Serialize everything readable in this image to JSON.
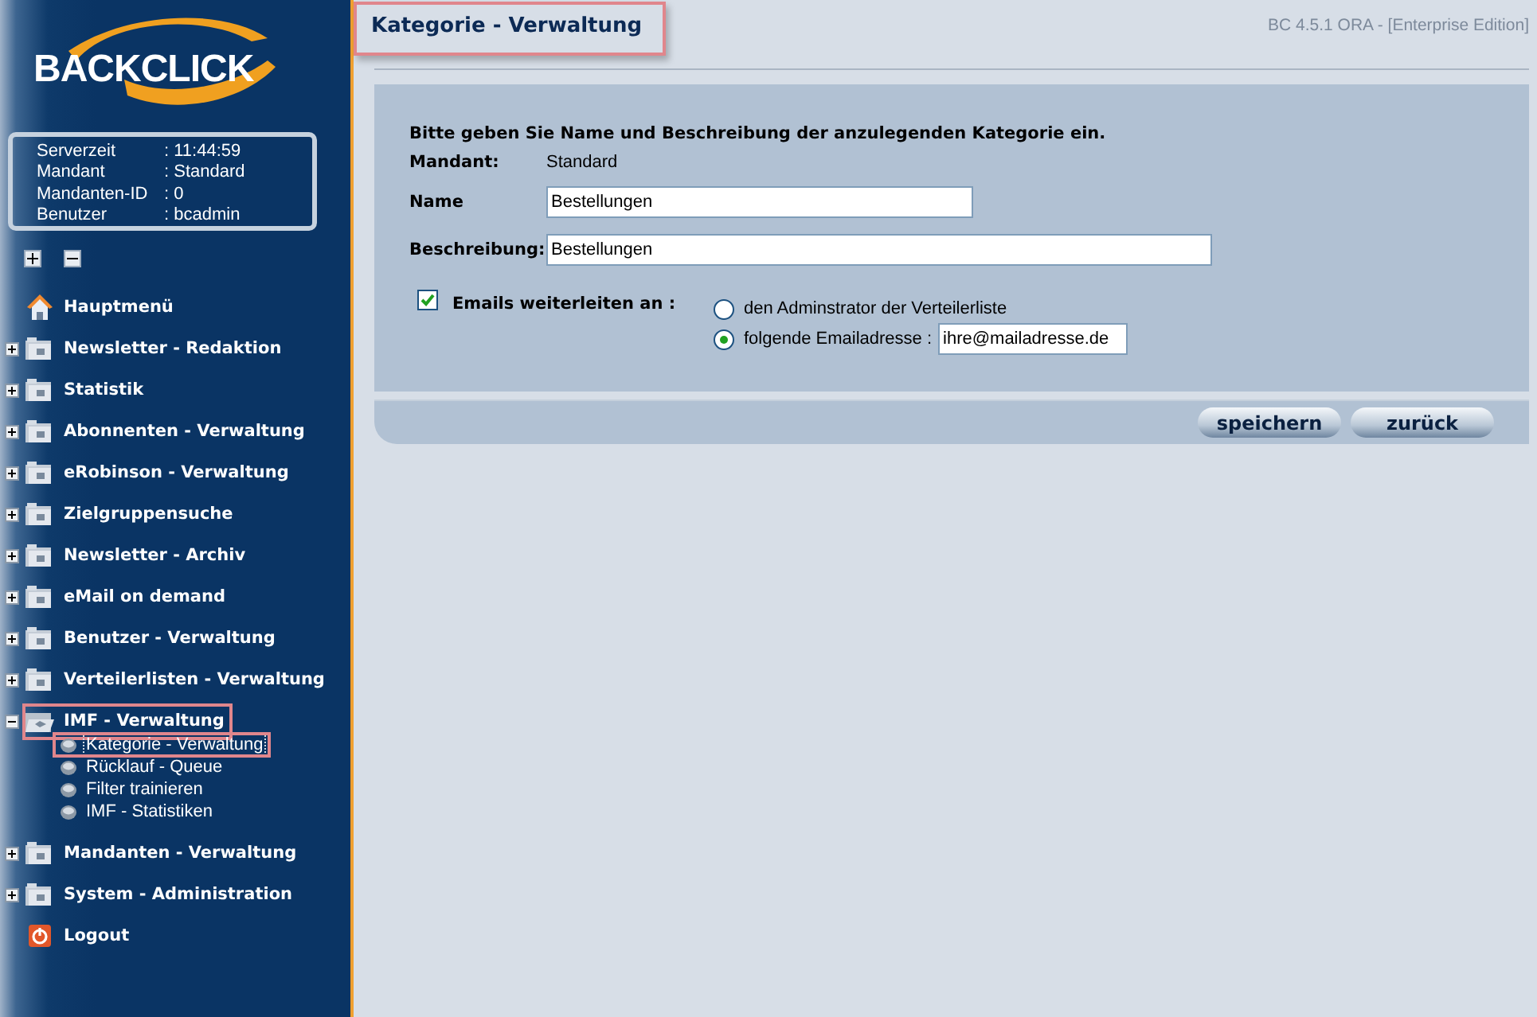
{
  "sidebar": {
    "logo": "BACKCLICK",
    "info": [
      {
        "label": "Serverzeit",
        "value": ": 11:44:59"
      },
      {
        "label": "Mandant",
        "value": ": Standard"
      },
      {
        "label": "Mandanten-ID",
        "value": ": 0"
      },
      {
        "label": "Benutzer",
        "value": ": bcadmin"
      }
    ],
    "tree": [
      {
        "kind": "home",
        "label": "Hauptmenü"
      },
      {
        "kind": "folder",
        "label": "Newsletter - Redaktion",
        "expanded": false,
        "selected": false
      },
      {
        "kind": "folder",
        "label": "Statistik",
        "expanded": false,
        "selected": false
      },
      {
        "kind": "folder",
        "label": "Abonnenten - Verwaltung",
        "expanded": false,
        "selected": false
      },
      {
        "kind": "folder",
        "label": "eRobinson - Verwaltung",
        "expanded": false,
        "selected": false
      },
      {
        "kind": "folder",
        "label": "Zielgruppensuche",
        "expanded": false,
        "selected": false
      },
      {
        "kind": "folder",
        "label": "Newsletter - Archiv",
        "expanded": false,
        "selected": false
      },
      {
        "kind": "folder",
        "label": "eMail on demand",
        "expanded": false,
        "selected": false
      },
      {
        "kind": "folder",
        "label": "Benutzer - Verwaltung",
        "expanded": false,
        "selected": false
      },
      {
        "kind": "folder",
        "label": "Verteilerlisten - Verwaltung",
        "expanded": false,
        "selected": false
      },
      {
        "kind": "folder",
        "label": "IMF - Verwaltung",
        "expanded": true,
        "selected": true,
        "children": [
          {
            "label": "Kategorie - Verwaltung",
            "selected": true
          },
          {
            "label": "Rücklauf - Queue",
            "selected": false
          },
          {
            "label": "Filter trainieren",
            "selected": false
          },
          {
            "label": "IMF - Statistiken",
            "selected": false
          }
        ]
      },
      {
        "kind": "folder",
        "label": "Mandanten - Verwaltung",
        "expanded": false,
        "selected": false
      },
      {
        "kind": "folder",
        "label": "System - Administration",
        "expanded": false,
        "selected": false
      },
      {
        "kind": "logout",
        "label": "Logout"
      }
    ]
  },
  "header": {
    "title": "Kategorie - Verwaltung",
    "version": "BC 4.5.1 ORA - [Enterprise Edition]"
  },
  "form": {
    "instruction": "Bitte geben Sie Name und Beschreibung der anzulegenden Kategorie ein.",
    "mandant": {
      "label": "Mandant:",
      "value": "Standard"
    },
    "name": {
      "label": "Name",
      "value": "Bestellungen"
    },
    "description": {
      "label": "Beschreibung:",
      "value": "Bestellungen"
    },
    "forward": {
      "label": "Emails weiterleiten an :",
      "checked": true
    },
    "options": [
      {
        "label": "den Adminstrator der Verteilerliste",
        "selected": false
      },
      {
        "label": "folgende Emailadresse :",
        "selected": true,
        "value": "ihre@mailadresse.de"
      }
    ]
  },
  "buttons": [
    "speichern",
    "zurück"
  ]
}
